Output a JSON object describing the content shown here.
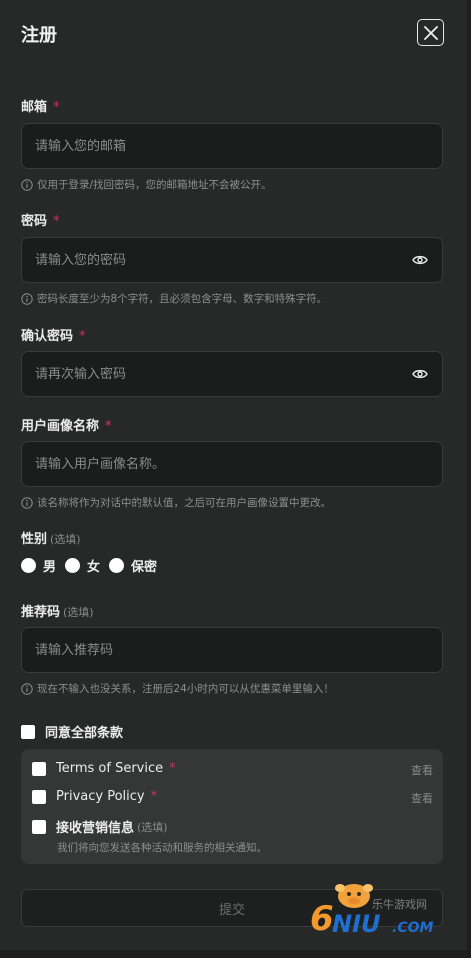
{
  "header": {
    "title": "注册"
  },
  "email": {
    "label": "邮箱",
    "required_mark": "*",
    "placeholder": "请输入您的邮箱",
    "hint": "仅用于登录/找回密码，您的邮箱地址不会被公开。"
  },
  "password": {
    "label": "密码",
    "required_mark": "*",
    "placeholder": "请输入您的密码",
    "hint": "密码长度至少为8个字符，且必须包含字母、数字和特殊字符。"
  },
  "confirm_password": {
    "label": "确认密码",
    "required_mark": "*",
    "placeholder": "请再次输入密码"
  },
  "persona_name": {
    "label": "用户画像名称",
    "required_mark": "*",
    "placeholder": "请输入用户画像名称。",
    "hint": "该名称将作为对话中的默认值，之后可在用户画像设置中更改。"
  },
  "gender": {
    "label": "性别",
    "optional": "(选填)",
    "options": [
      "男",
      "女",
      "保密"
    ]
  },
  "referral": {
    "label": "推荐码",
    "optional": "(选填)",
    "placeholder": "请输入推荐码",
    "hint": "现在不输入也没关系，注册后24小时内可以从优惠菜单里输入！"
  },
  "agreements": {
    "agree_all": "同意全部条款",
    "items": [
      {
        "label": "Terms of Service",
        "mark": "*",
        "view": "查看"
      },
      {
        "label": "Privacy Policy",
        "mark": "*",
        "view": "查看"
      },
      {
        "label": "接收营销信息",
        "optional": "(选填)"
      }
    ],
    "marketing_note": "我们将向您发送各种活动和服务的相关通知。"
  },
  "submit": {
    "label": "提交"
  },
  "watermark": {
    "brand": "6NIU.COM",
    "sub": "乐牛游戏网"
  },
  "colors": {
    "background": "#272828",
    "input_bg": "#1b1c1c",
    "required": "#c23b63",
    "muted": "#8f8f8f"
  }
}
